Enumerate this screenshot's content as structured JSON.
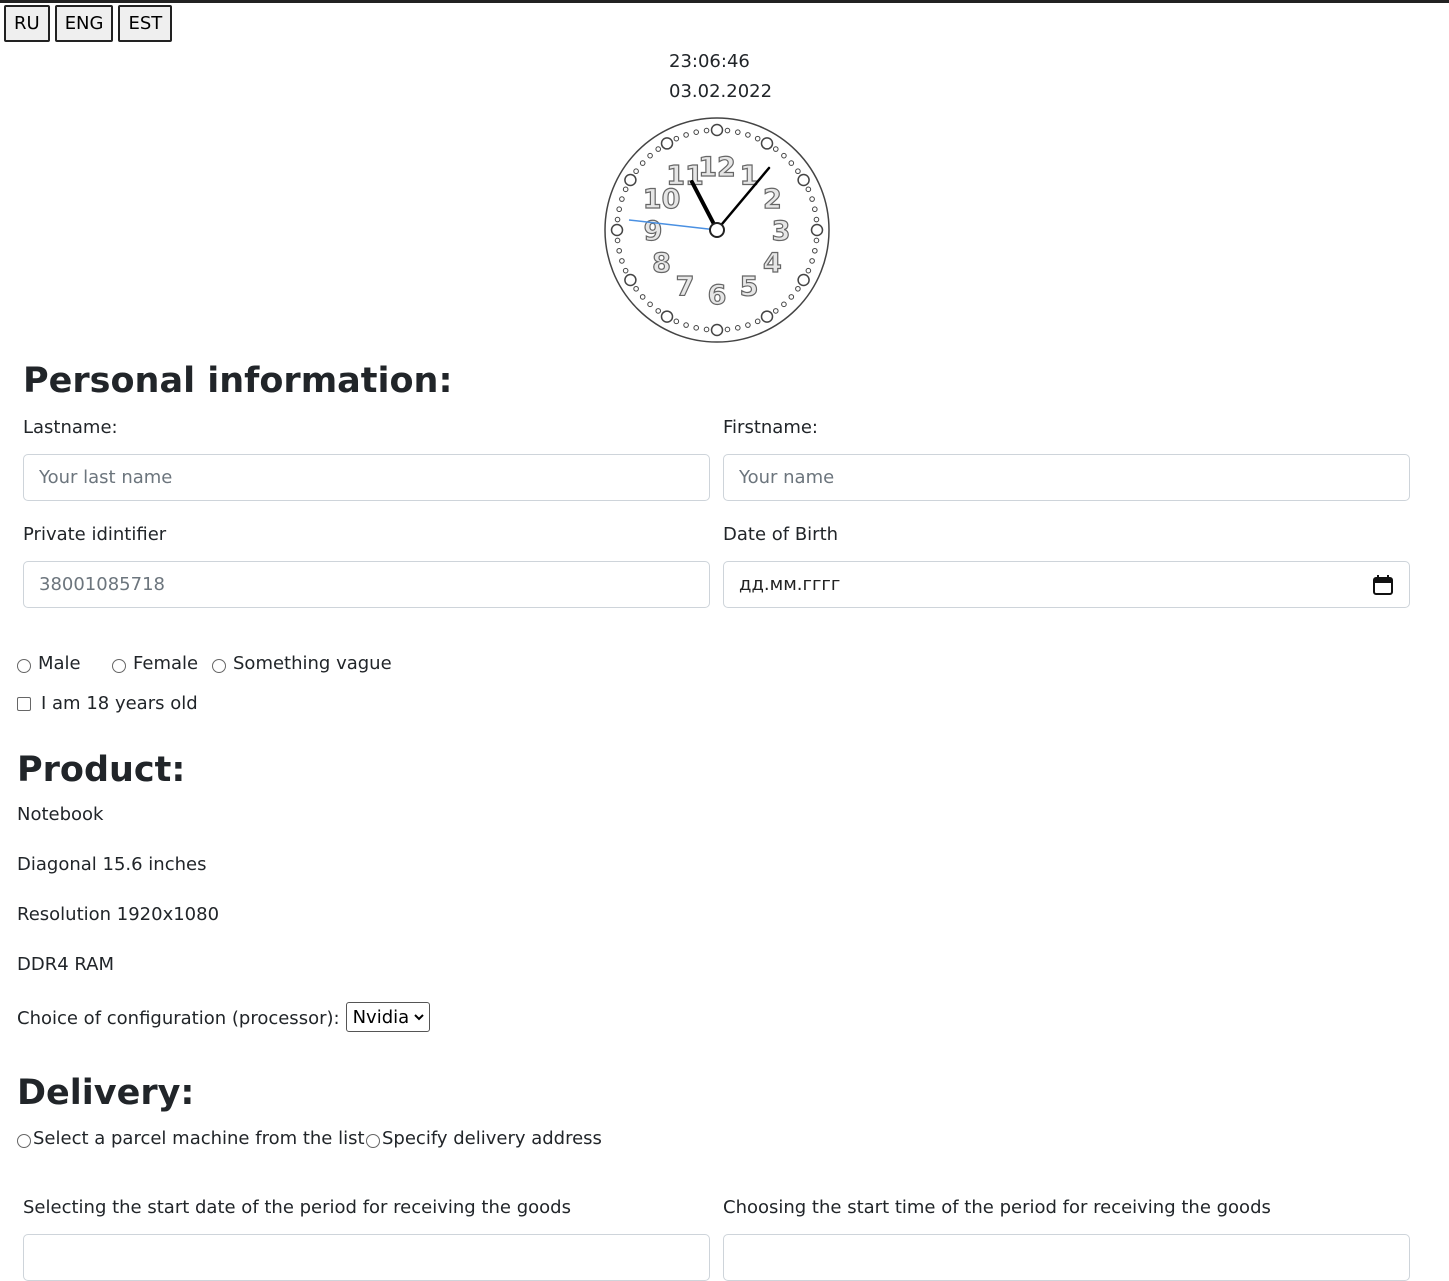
{
  "languages": [
    "RU",
    "ENG",
    "EST"
  ],
  "clock": {
    "time": "23:06:46",
    "date": "03.02.2022",
    "numbers": [
      "1",
      "2",
      "3",
      "4",
      "5",
      "6",
      "7",
      "8",
      "9",
      "10",
      "11",
      "12"
    ]
  },
  "personal": {
    "title": "Personal information:",
    "lastname_label": "Lastname:",
    "lastname_placeholder": "Your last name",
    "firstname_label": "Firstname:",
    "firstname_placeholder": "Your name",
    "id_label": "Private idintifier",
    "id_placeholder": "38001085718",
    "dob_label": "Date of Birth",
    "dob_placeholder": "дд.мм.гггг",
    "gender_options": [
      "Male",
      "Female",
      "Something vague"
    ],
    "age_checkbox": "I am 18 years old"
  },
  "product": {
    "title": "Product:",
    "lines": [
      "Notebook",
      "Diagonal 15.6 inches",
      "Resolution 1920x1080",
      "DDR4 RAM"
    ],
    "config_label": "Choice of configuration (processor):",
    "config_value": "Nvidia"
  },
  "delivery": {
    "title": "Delivery:",
    "options": [
      "Select a parcel machine from the list",
      "Specify delivery address"
    ],
    "start_date_label": "Selecting the start date of the period for receiving the goods",
    "start_time_label": "Choosing the start time of the period for receiving the goods"
  },
  "colors": {
    "second_hand": "#4a90e2",
    "text": "#212529",
    "border": "#ced4da"
  }
}
